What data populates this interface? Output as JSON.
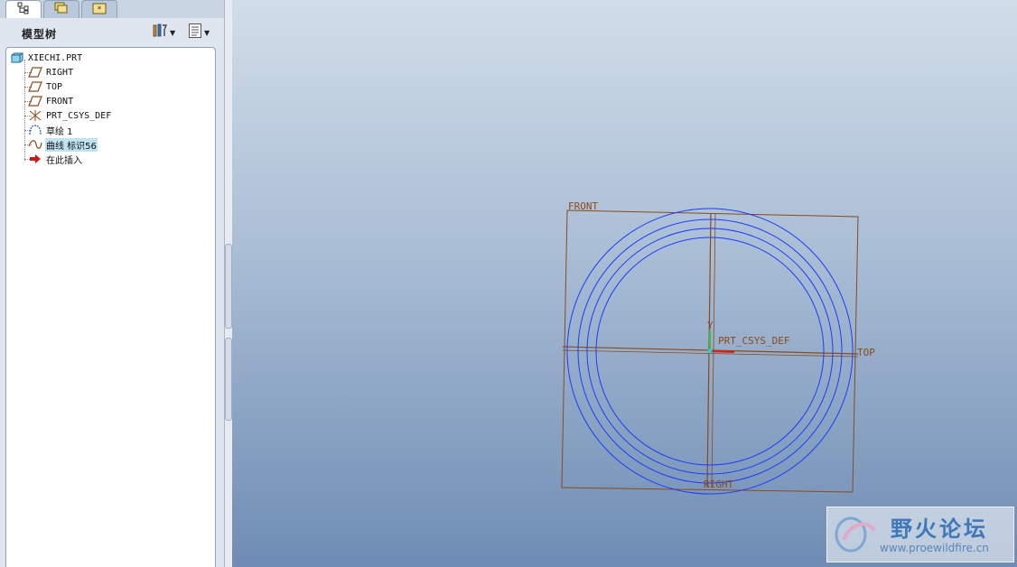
{
  "tabs": [
    {
      "icon": "model-tree-icon"
    },
    {
      "icon": "folder-browser-icon"
    },
    {
      "icon": "favorites-icon"
    }
  ],
  "model_tree": {
    "title": "模型树",
    "settings_icon": "tree-settings-icon",
    "show_icon": "tree-show-icon",
    "items": [
      {
        "label": "XIECHI.PRT",
        "icon": "part-icon"
      },
      {
        "label": "RIGHT",
        "icon": "datum-plane-icon"
      },
      {
        "label": "TOP",
        "icon": "datum-plane-icon"
      },
      {
        "label": "FRONT",
        "icon": "datum-plane-icon"
      },
      {
        "label": "PRT_CSYS_DEF",
        "icon": "csys-icon"
      },
      {
        "label": "草绘 1",
        "icon": "sketch-icon"
      },
      {
        "label": "曲线 标识56",
        "icon": "curve-icon",
        "selected": true
      },
      {
        "label": "在此插入",
        "icon": "insert-here-icon"
      }
    ]
  },
  "graphics": {
    "datum_labels": {
      "front": "FRONT",
      "top": "TOP",
      "right": "RIGHT",
      "csys": "PRT_CSYS_DEF",
      "y_axis": "Y"
    },
    "colors": {
      "datum": "#8a4b1a",
      "circles": "#1a3cff",
      "background_top": "#d1dde9",
      "background_bottom": "#6e8cb4"
    }
  },
  "watermark": {
    "title": "野火论坛",
    "url": "www.proewildfire.cn"
  }
}
